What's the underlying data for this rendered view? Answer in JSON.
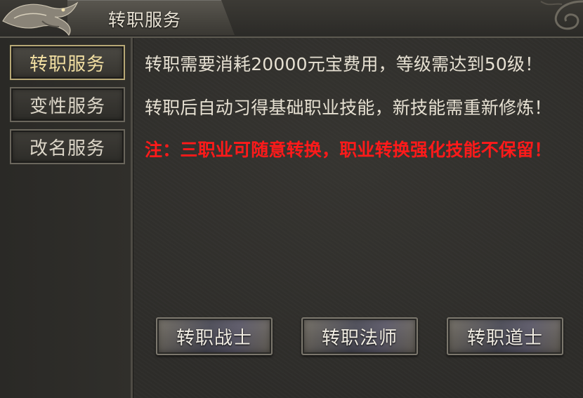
{
  "window": {
    "title": "转职服务"
  },
  "sidebar": {
    "items": [
      {
        "label": "转职服务",
        "active": true
      },
      {
        "label": "变性服务",
        "active": false
      },
      {
        "label": "改名服务",
        "active": false
      }
    ]
  },
  "content": {
    "lines": [
      "转职需要消耗20000元宝费用，等级需达到50级！",
      "转职后自动习得基础职业技能，新技能需重新修炼！",
      "注：三职业可随意转换，职业转换强化技能不保留！"
    ]
  },
  "actions": {
    "warrior": "转职战士",
    "mage": "转职法师",
    "taoist": "转职道士"
  },
  "colors": {
    "warning": "#ff1a1a",
    "active_label": "#f2dfa2",
    "text": "#e6e0d2"
  }
}
